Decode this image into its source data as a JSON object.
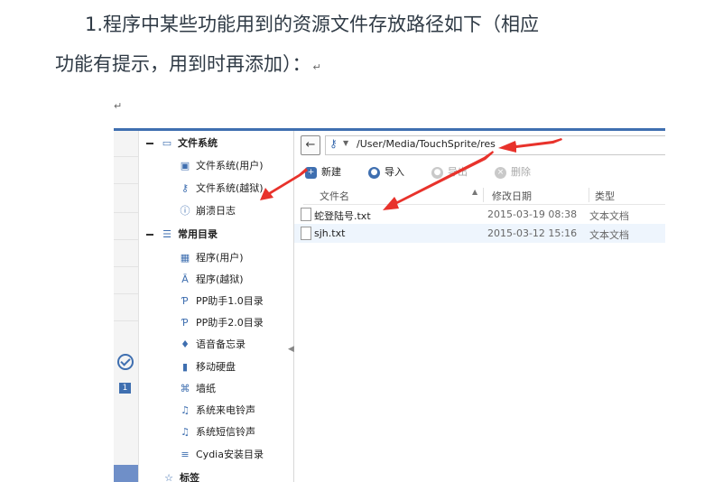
{
  "paragraph": {
    "line1": "1.程序中某些功能用到的资源文件存放路径如下（相应",
    "line2": "功能有提示，用到时再添加）：",
    "pilcrow": "↵"
  },
  "screenshot": {
    "left_strip": {
      "badge": "1"
    },
    "path_bar": {
      "back": "←",
      "dropdown": "▼",
      "path": "/User/Media/TouchSprite/res"
    },
    "toolbar": [
      {
        "label": "新建",
        "icon": "plus-icon",
        "enabled": true
      },
      {
        "label": "导入",
        "icon": "import-icon",
        "enabled": true
      },
      {
        "label": "导出",
        "icon": "export-icon",
        "enabled": false
      },
      {
        "label": "删除",
        "icon": "delete-icon",
        "enabled": false
      }
    ],
    "tree": {
      "group1": "文件系统",
      "items1": [
        "文件系统(用户)",
        "文件系统(越狱)",
        "崩溃日志"
      ],
      "group2": "常用目录",
      "items2": [
        "程序(用户)",
        "程序(越狱)",
        "PP助手1.0目录",
        "PP助手2.0目录",
        "语音备忘录",
        "移动硬盘",
        "墙纸",
        "系统来电铃声",
        "系统短信铃声",
        "Cydia安装目录"
      ],
      "group3": "标签"
    },
    "columns": [
      "文件名",
      "修改日期",
      "类型"
    ],
    "files": [
      {
        "name": "蛇登陆号.txt",
        "date": "2015-03-19 08:38",
        "type": "文本文档"
      },
      {
        "name": "sjh.txt",
        "date": "2015-03-12 15:16",
        "type": "文本文档"
      }
    ],
    "accent_color": "#3f6fb0",
    "arrow_color": "#e8322b"
  }
}
